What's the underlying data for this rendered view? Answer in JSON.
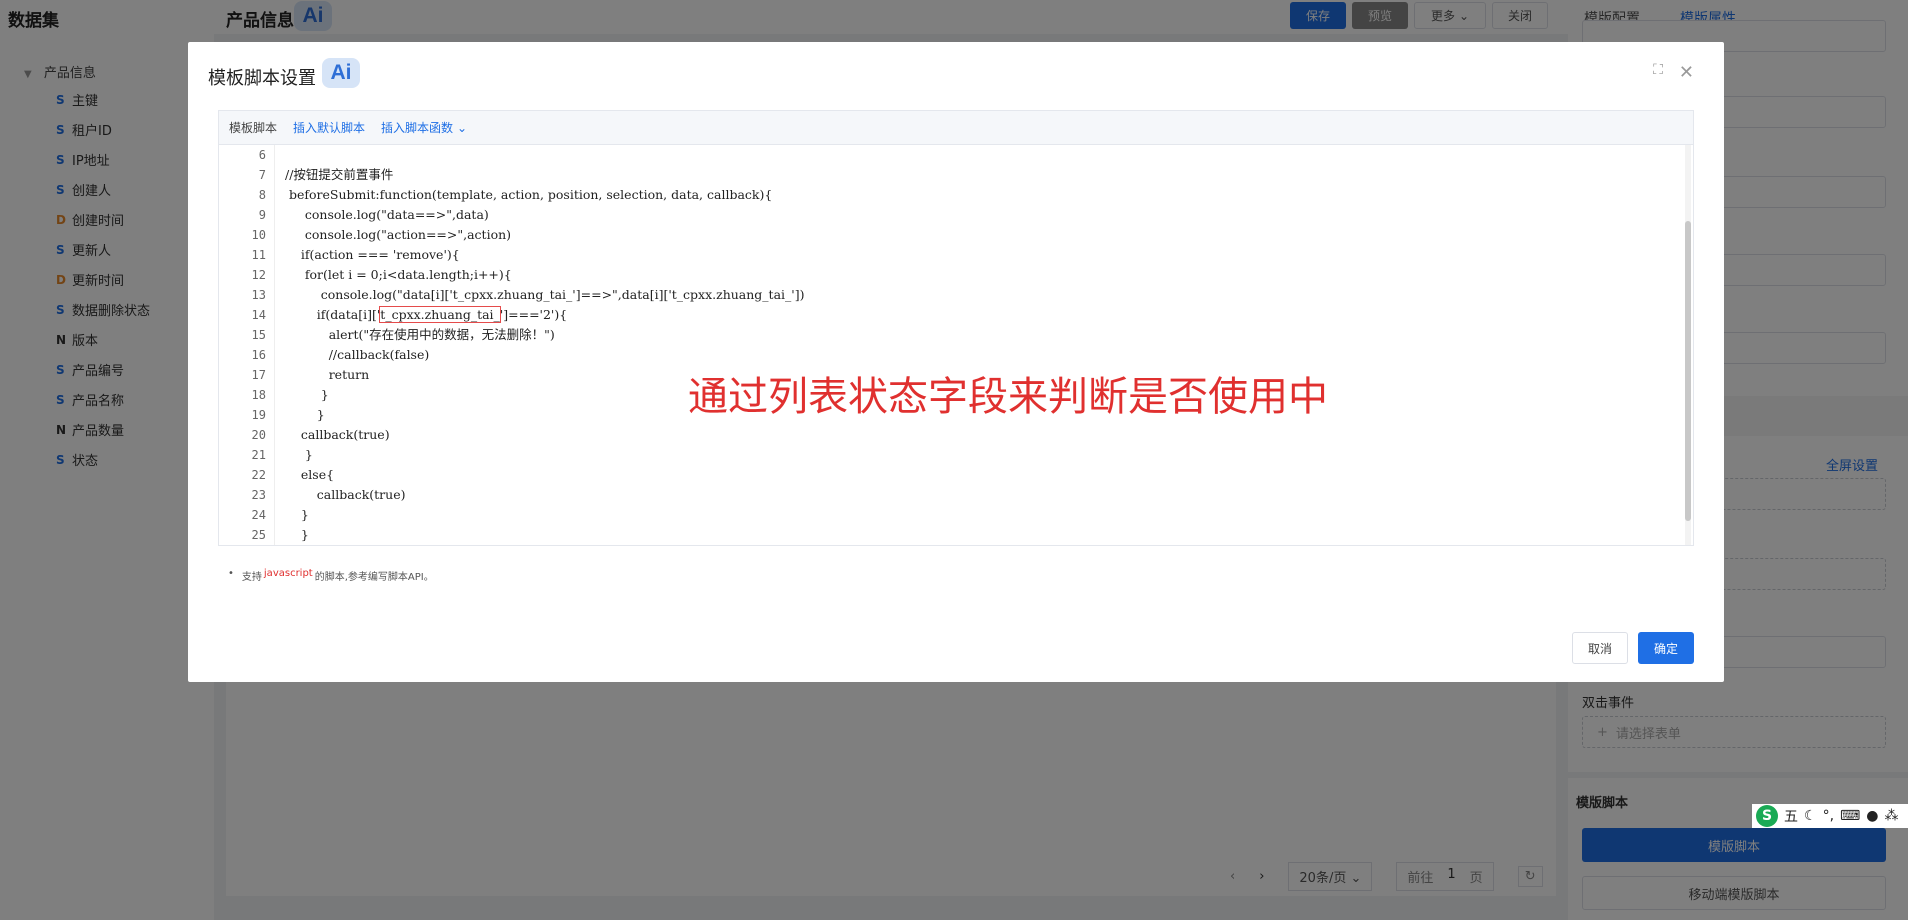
{
  "app": {
    "title": "数据集"
  },
  "header": {
    "page_title": "产品信息",
    "ai_label": "Ai",
    "buttons": {
      "save": "保存",
      "preview": "预览",
      "more": "更多",
      "close": "关闭"
    },
    "tabs": [
      "模版配置",
      "模版属性"
    ],
    "active_tab": "模版属性",
    "accent_color": "#1f6fe5"
  },
  "tree": {
    "root": "产品信息",
    "items": [
      {
        "type": "S",
        "label": "主键",
        "color": "#1f6fe5"
      },
      {
        "type": "S",
        "label": "租户ID",
        "color": "#1f6fe5"
      },
      {
        "type": "S",
        "label": "IP地址",
        "color": "#1f6fe5"
      },
      {
        "type": "S",
        "label": "创建人",
        "color": "#1f6fe5"
      },
      {
        "type": "D",
        "label": "创建时间",
        "color": "#e6892b"
      },
      {
        "type": "S",
        "label": "更新人",
        "color": "#1f6fe5"
      },
      {
        "type": "D",
        "label": "更新时间",
        "color": "#e6892b"
      },
      {
        "type": "S",
        "label": "数据删除状态",
        "color": "#1f6fe5"
      },
      {
        "type": "N",
        "label": "版本",
        "color": "#333333"
      },
      {
        "type": "S",
        "label": "产品编号",
        "color": "#1f6fe5"
      },
      {
        "type": "S",
        "label": "产品名称",
        "color": "#1f6fe5"
      },
      {
        "type": "N",
        "label": "产品数量",
        "color": "#333333"
      },
      {
        "type": "S",
        "label": "状态",
        "color": "#1f6fe5"
      }
    ]
  },
  "pager": {
    "page_size": "20条/页",
    "goto_label": "前往",
    "page": "1",
    "page_unit": "页"
  },
  "right_panel": {
    "fullscreen_link": "全屏设置",
    "dblclick_label": "双击事件",
    "select_form_placeholder": "请选择表单",
    "script_section_title": "模版脚本",
    "script_button": "模版脚本",
    "mobile_script_button": "移动端模版脚本"
  },
  "ime": {
    "logo": "S",
    "mode": "五"
  },
  "dialog": {
    "title": "模板脚本设置",
    "ai_label": "Ai",
    "toolbar": {
      "label": "模板脚本",
      "insert_default": "插入默认脚本",
      "insert_function": "插入脚本函数"
    },
    "first_line_no": 6,
    "code_lines": [
      "",
      "//按钮提交前置事件",
      " beforeSubmit:function(template, action, position, selection, data, callback){",
      "     console.log(\"data==>\",data)",
      "     console.log(\"action==>\",action)",
      "    if(action === 'remove'){",
      "     for(let i = 0;i<data.length;i++){",
      "         console.log(\"data[i]['t_cpxx.zhuang_tai_']==>\",data[i]['t_cpxx.zhuang_tai_'])",
      "        if(data[i]['t_cpxx.zhuang_tai_']==='2'){",
      "           alert(\"存在使用中的数据，无法删除！\")",
      "           //callback(false)",
      "           return",
      "         }",
      "        }",
      "    callback(true)",
      "     }",
      "    else{",
      "        callback(true)",
      "    }",
      "    }"
    ],
    "highlight": "t_cpxx.zhuang_tai_",
    "annotation": "通过列表状态字段来判断是否使用中",
    "tip": {
      "prefix": "支持",
      "highlight": "javascript",
      "suffix": "的脚本,参考编写脚本API。"
    },
    "buttons": {
      "cancel": "取消",
      "confirm": "确定"
    }
  }
}
